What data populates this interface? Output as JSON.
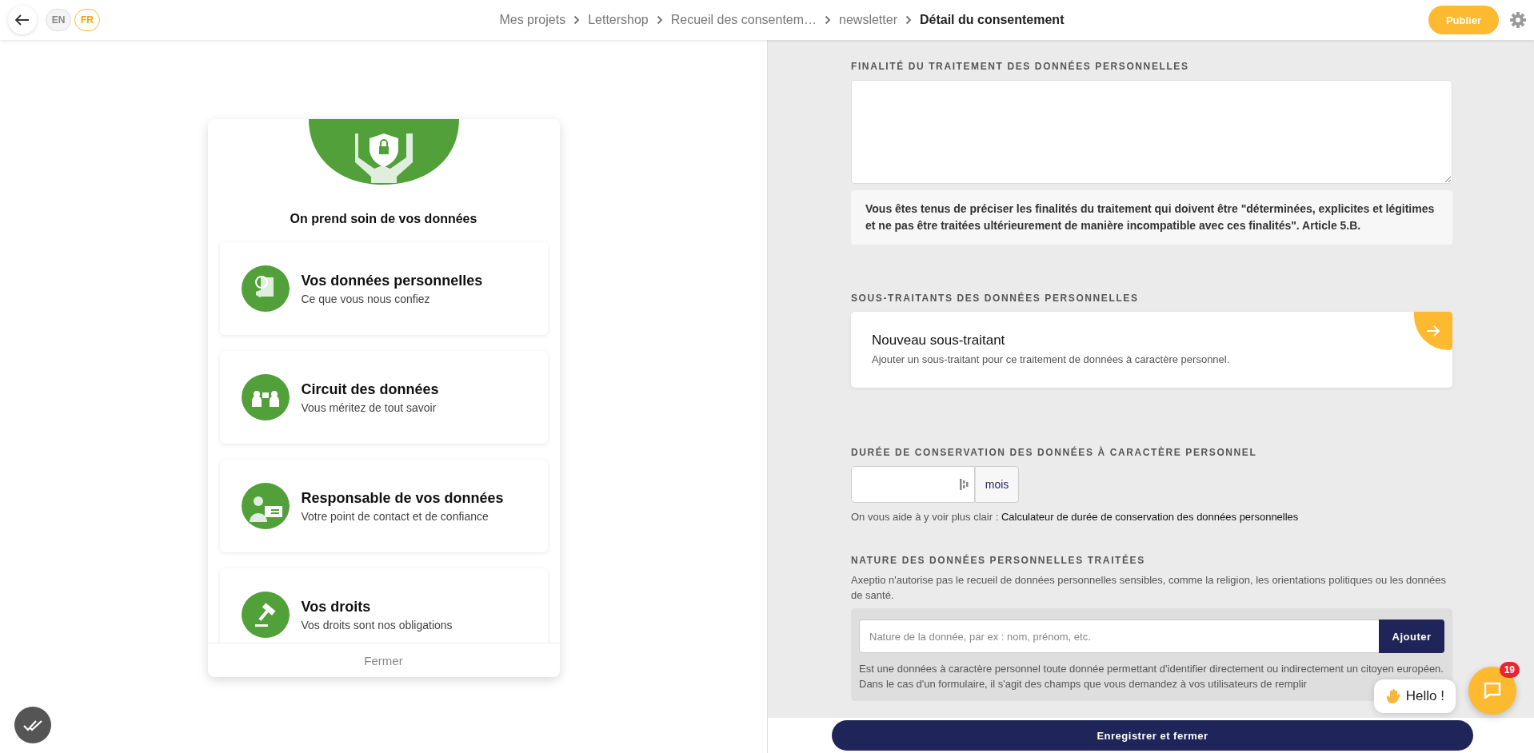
{
  "topbar": {
    "languages": [
      {
        "label": "EN",
        "selected": false
      },
      {
        "label": "FR",
        "selected": true
      }
    ],
    "breadcrumbs": [
      {
        "label": "Mes projets",
        "current": false
      },
      {
        "label": "Lettershop",
        "current": false
      },
      {
        "label": "Recueil des consentem…",
        "current": false
      },
      {
        "label": "newsletter",
        "current": false
      },
      {
        "label": "Détail du consentement",
        "current": true
      }
    ],
    "publish": "Publier"
  },
  "modal": {
    "title": "On prend soin de vos données",
    "items": [
      {
        "title": "Vos données personnelles",
        "subtitle": "Ce que vous nous confiez"
      },
      {
        "title": "Circuit des données",
        "subtitle": "Vous méritez de tout savoir"
      },
      {
        "title": "Responsable de vos données",
        "subtitle": "Votre point de contact et de confiance"
      },
      {
        "title": "Vos droits",
        "subtitle": "Vos droits sont nos obligations"
      }
    ],
    "close": "Fermer"
  },
  "form": {
    "purpose": {
      "label": "FINALITÉ DU TRAITEMENT DES DONNÉES PERSONNELLES",
      "note": "Vous êtes tenus de préciser les finalités du traitement qui doivent être \"déterminées, explicites et légitimes et ne pas être traitées ultérieurement de manière incompatible avec ces finalités\". Article 5.B."
    },
    "subcontractors": {
      "label": "SOUS-TRAITANTS DES DONNÉES PERSONNELLES",
      "card_title": "Nouveau sous-traitant",
      "card_text": "Ajouter un sous-traitant pour ce traitement de données à caractère personnel."
    },
    "retention": {
      "label": "DURÉE DE CONSERVATION DES DONNÉES À CARACTÈRE PERSONNEL",
      "unit": "mois",
      "help": "On vous aide à y voir plus clair :",
      "link": "Calculateur de durée de conservation des données personnelles"
    },
    "nature": {
      "label": "NATURE DES DONNÉES PERSONNELLES TRAITÉES",
      "description": "Axeptio n'autorise pas le recueil de données personnelles sensibles, comme la religion, les orientations politiques ou les données de santé.",
      "placeholder": "Nature de la donnée, par ex : nom, prénom, etc.",
      "add": "Ajouter",
      "hint_1": "Est une données à caractère personnel toute donnée permettant d'identifier directement ou indirectement un citoyen européen.",
      "hint_2": "Dans le cas d'un formulaire, il s'agit des champs que vous demandez à vos utilisateurs de remplir"
    },
    "save": "Enregistrer et fermer"
  },
  "chat": {
    "greeting": "Hello !",
    "badge": "19"
  }
}
